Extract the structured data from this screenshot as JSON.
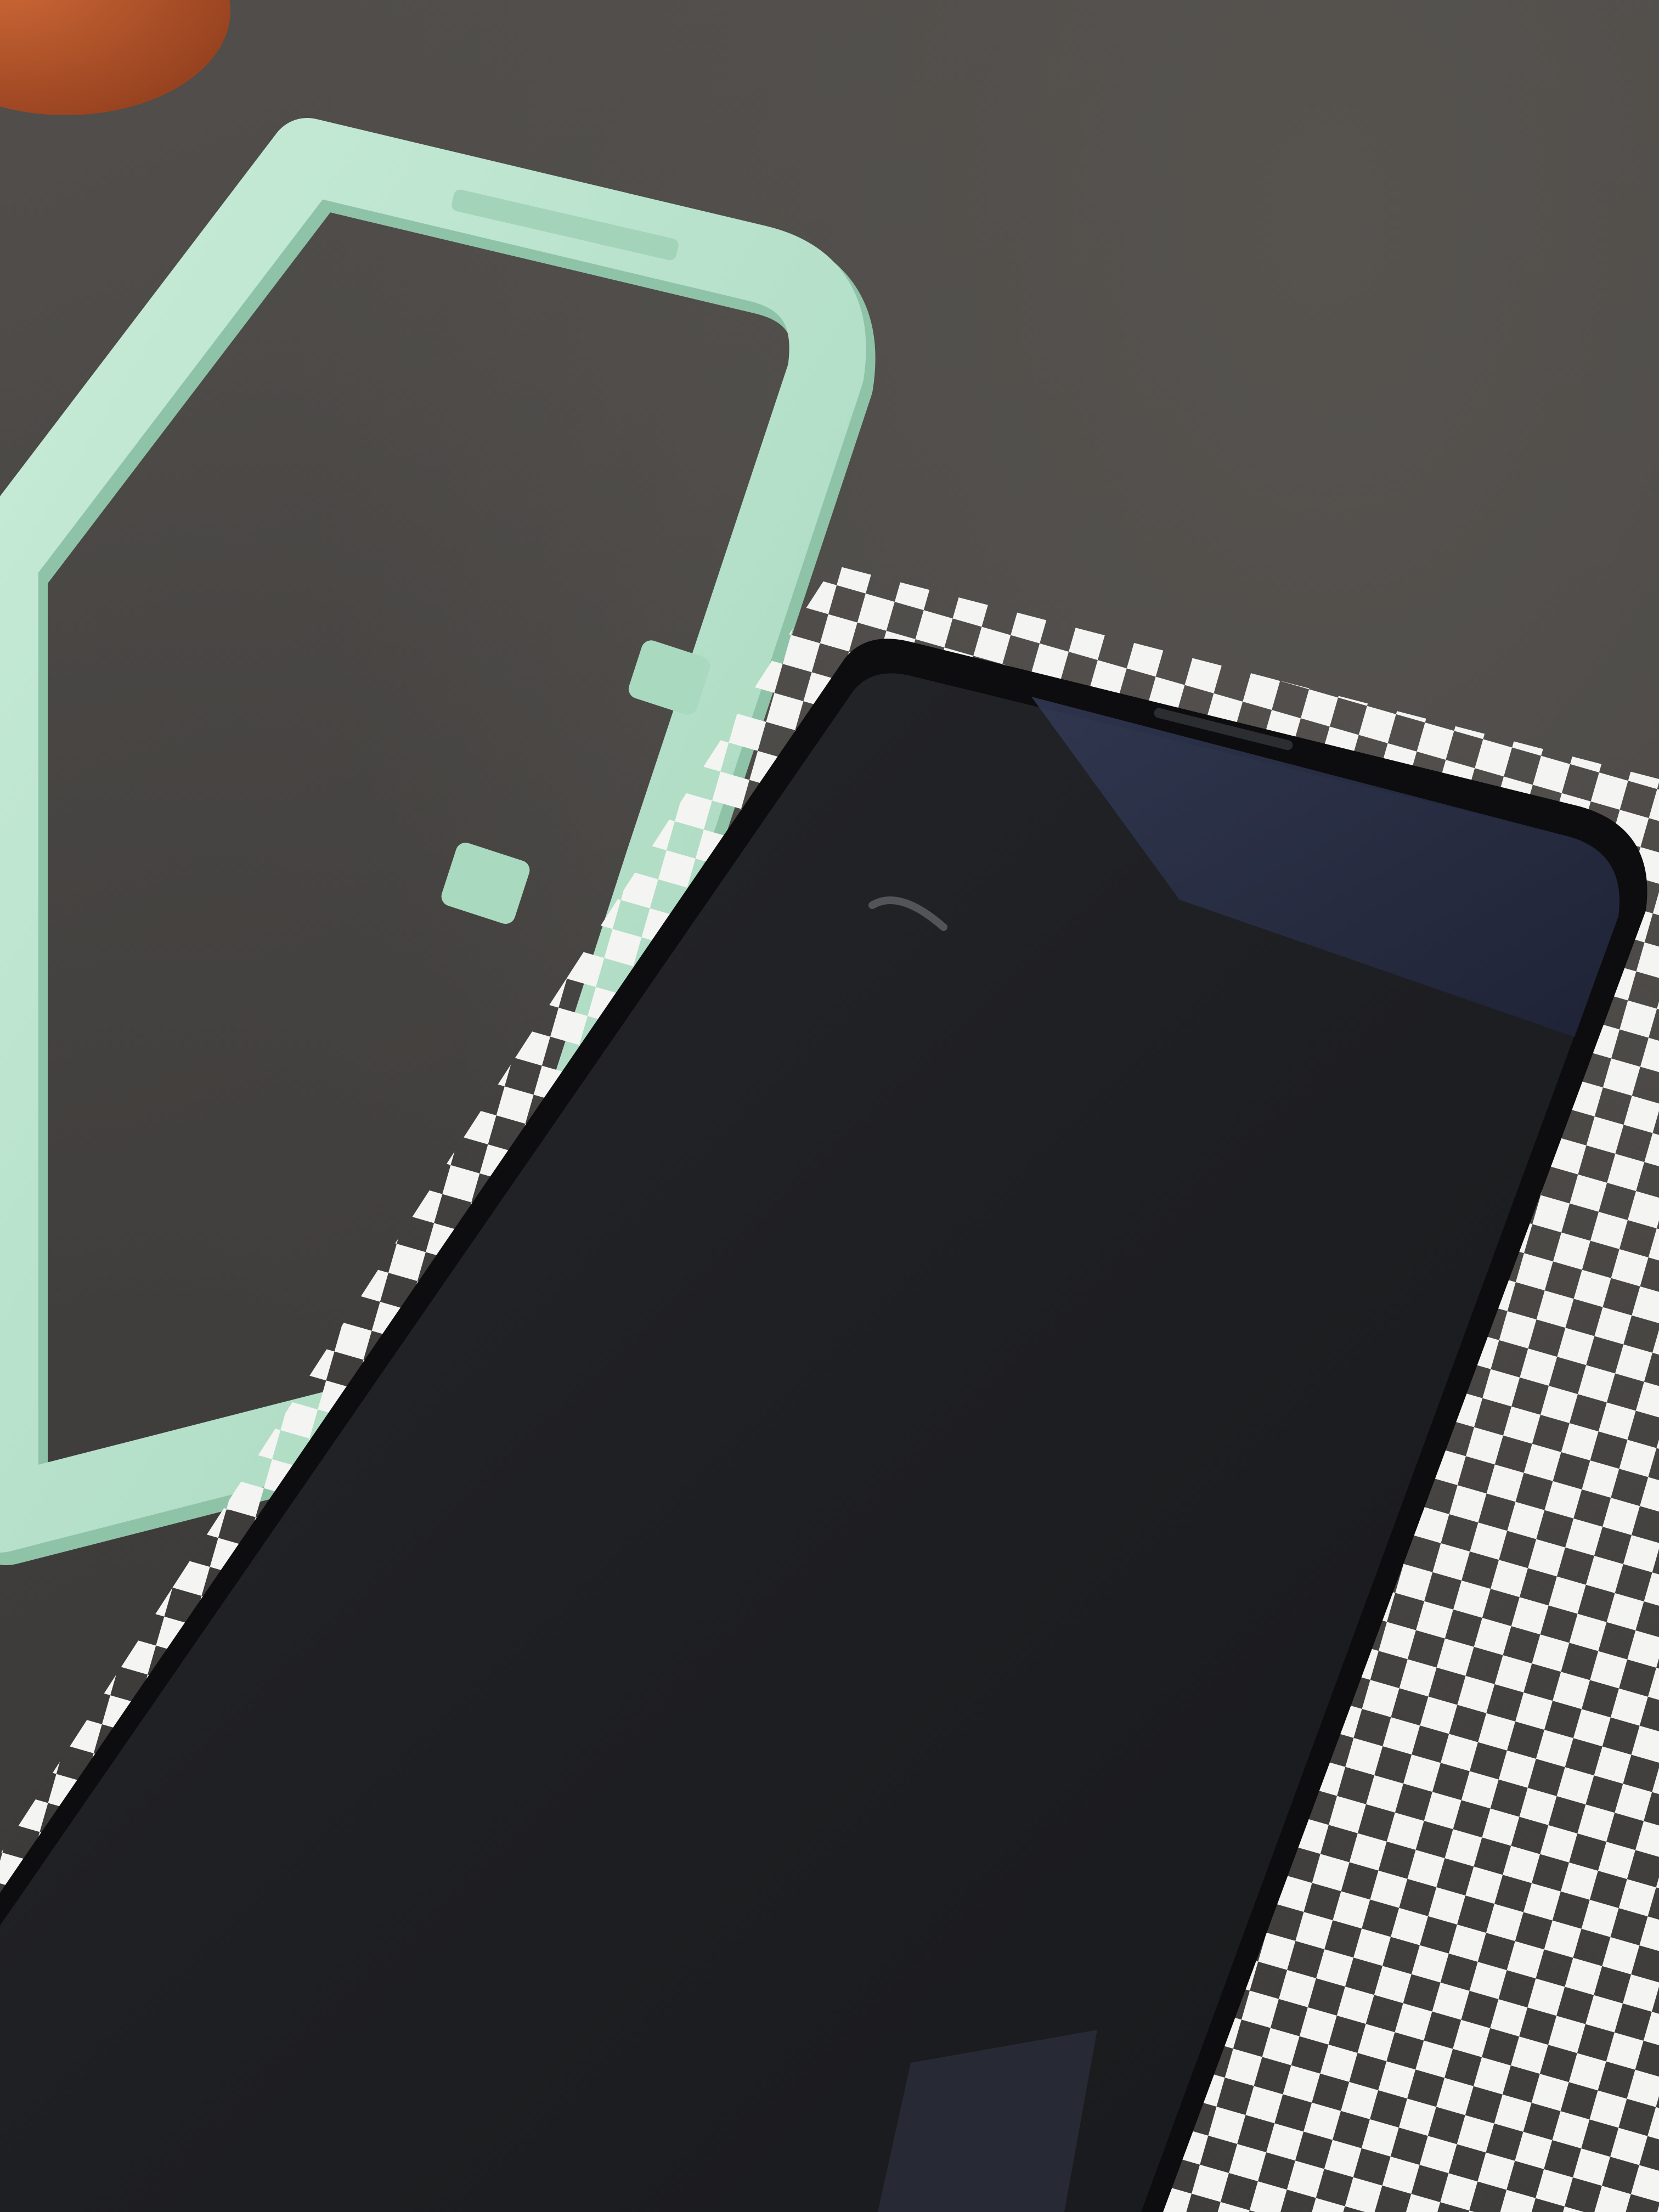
{
  "scene": {
    "description_tags": [
      "dark-desk-surface",
      "mint-alignment-frame",
      "smartphone-dark-screen",
      "white-checkered-mat",
      "orange-object-corner"
    ],
    "colors": {
      "desk": "#4a4847",
      "frame": "#b8e3cc",
      "frame_shadow": "#8fc3a8",
      "phone_body": "#0d0d0f",
      "phone_screen": "#1f1f23",
      "screen_reflection": "#2e3448",
      "mat_squares": "#f4f4f2",
      "orange_object": "#b5532a"
    }
  }
}
